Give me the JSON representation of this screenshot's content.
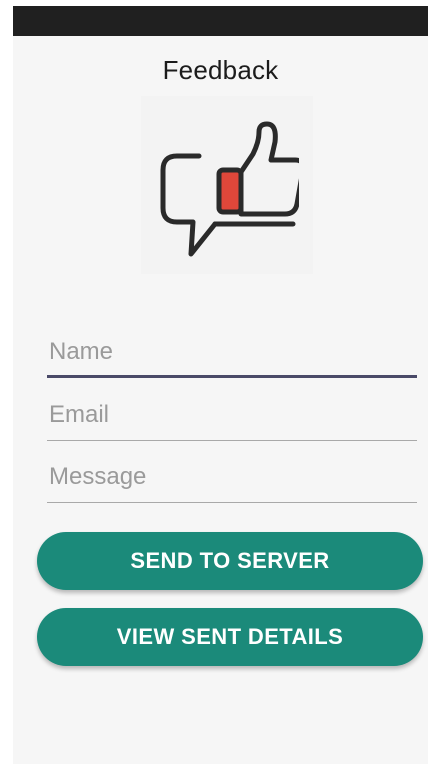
{
  "header": {
    "title": "Feedback"
  },
  "logo": {
    "icon": "feedback-thumbs-up-icon",
    "accent_color": "#e0473a",
    "stroke_color": "#2a2a2a"
  },
  "form": {
    "name": {
      "value": "",
      "placeholder": "Name"
    },
    "email": {
      "value": "",
      "placeholder": "Email"
    },
    "message": {
      "value": "",
      "placeholder": "Message"
    }
  },
  "actions": {
    "send_label": "SEND TO SERVER",
    "view_label": "VIEW SENT DETAILS"
  },
  "colors": {
    "button": "#1b8a7a",
    "status_bar": "#202020",
    "focused_underline": "#4a4a68"
  }
}
